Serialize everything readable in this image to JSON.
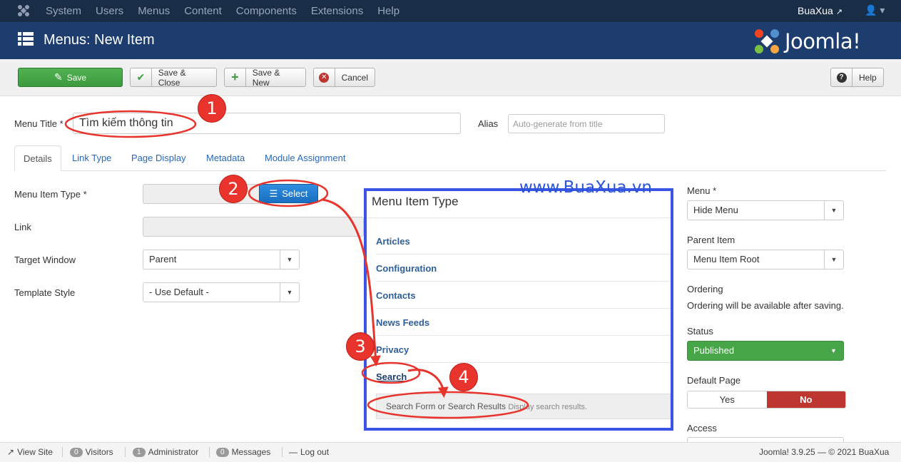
{
  "topnav": {
    "menu": [
      "System",
      "Users",
      "Menus",
      "Content",
      "Components",
      "Extensions",
      "Help"
    ],
    "site_name": "BuaXua",
    "user_caret": "▾"
  },
  "header": {
    "title": "Menus: New Item",
    "brand": "Joomla!"
  },
  "toolbar": {
    "save": "Save",
    "save_close": "Save & Close",
    "save_new": "Save & New",
    "cancel": "Cancel",
    "help": "Help"
  },
  "form": {
    "menu_title_label": "Menu Title *",
    "menu_title_value": "Tìm kiếm thông tin",
    "alias_label": "Alias",
    "alias_placeholder": "Auto-generate from title",
    "tabs": [
      "Details",
      "Link Type",
      "Page Display",
      "Metadata",
      "Module Assignment"
    ],
    "menu_item_type_label": "Menu Item Type *",
    "select_button": "Select",
    "link_label": "Link",
    "target_window_label": "Target Window",
    "target_window_value": "Parent",
    "template_style_label": "Template Style",
    "template_style_value": "- Use Default -"
  },
  "modal": {
    "title": "Menu Item Type",
    "items": [
      "Articles",
      "Configuration",
      "Contacts",
      "News Feeds",
      "Privacy",
      "Search"
    ],
    "sub_item": "Search Form or Search Results",
    "sub_hint": "Display search results."
  },
  "right": {
    "menu_label": "Menu *",
    "menu_value": "Hide Menu",
    "parent_label": "Parent Item",
    "parent_value": "Menu Item Root",
    "ordering_label": "Ordering",
    "ordering_text": "Ordering will be available after saving.",
    "status_label": "Status",
    "status_value": "Published",
    "default_label": "Default Page",
    "default_yes": "Yes",
    "default_no": "No",
    "access_label": "Access"
  },
  "statusbar": {
    "view_site": "View Site",
    "visitors_count": "0",
    "visitors": "Visitors",
    "admin_count": "1",
    "admin": "Administrator",
    "messages_count": "0",
    "messages": "Messages",
    "logout": "Log out",
    "version": "Joomla! 3.9.25 — © 2021 BuaXua"
  },
  "annotations": {
    "watermark": "www.BuaXua.vn",
    "steps": [
      "1",
      "2",
      "3",
      "4"
    ]
  }
}
